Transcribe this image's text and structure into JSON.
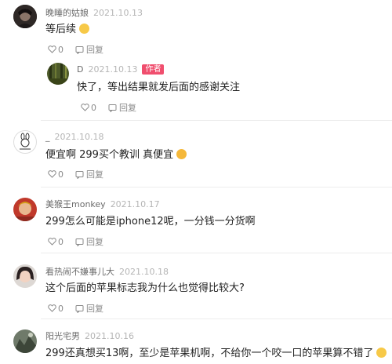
{
  "comments": [
    {
      "name": "晚睡的姑娘",
      "date": "2021.10.13",
      "text": "等后续",
      "emoji": "smirk-emoji",
      "likes": "0",
      "reply_label": "回复",
      "reply": {
        "name": "D",
        "date": "2021.10.13",
        "badge": "作者",
        "text": "快了，等出结果就发后面的感谢关注",
        "likes": "0",
        "reply_label": "回复"
      }
    },
    {
      "name": "_",
      "date": "2021.10.18",
      "text": "便宜啊 299买个教训 真便宜",
      "emoji": "laughing-emoji",
      "likes": "0",
      "reply_label": "回复"
    },
    {
      "name": "美猴王monkey",
      "date": "2021.10.17",
      "text": "299怎么可能是iphone12呢，一分钱一分货啊",
      "likes": "0",
      "reply_label": "回复"
    },
    {
      "name": "看热闹不嫌事儿大",
      "date": "2021.10.18",
      "text": "这个后面的苹果标志我为什么也觉得比较大?",
      "likes": "0",
      "reply_label": "回复"
    },
    {
      "name": "阳光宅男",
      "date": "2021.10.16",
      "text": "299还真想买13啊，至少是苹果机啊，不给你一个咬一口的苹果算不错了",
      "emoji": "sweat-smile-emoji"
    }
  ],
  "colors": {
    "author_badge": "#f04e6e",
    "meta": "#b5b5b5",
    "name": "#6b6b6b"
  }
}
